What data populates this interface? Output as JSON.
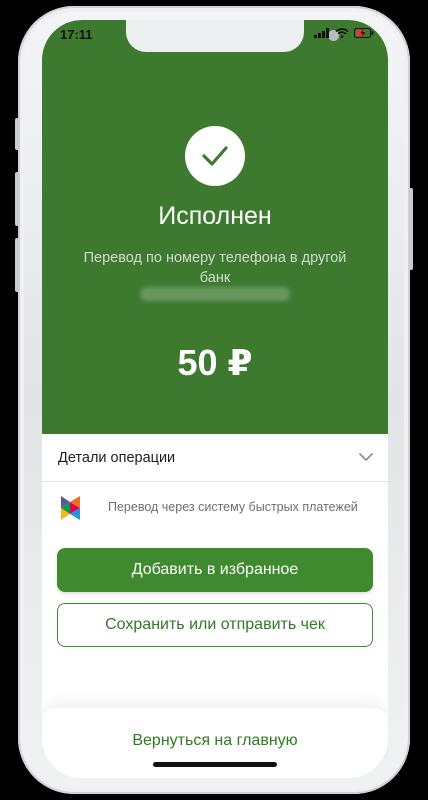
{
  "status_bar": {
    "time": "17:11"
  },
  "result": {
    "title": "Исполнен",
    "subtitle": "Перевод по номеру телефона в другой банк",
    "amount": "50 ₽"
  },
  "details": {
    "label": "Детали операции"
  },
  "sbp": {
    "text": "Перевод через систему быстрых платежей"
  },
  "buttons": {
    "favorite": "Добавить в избранное",
    "receipt": "Сохранить или отправить чек",
    "home": "Вернуться на главную"
  },
  "colors": {
    "accent": "#3d7a30",
    "button": "#3f8a2e"
  },
  "icons": [
    "check-icon",
    "chevron-down-icon",
    "sbp-logo-icon",
    "signal-icon",
    "wifi-icon",
    "battery-icon"
  ]
}
